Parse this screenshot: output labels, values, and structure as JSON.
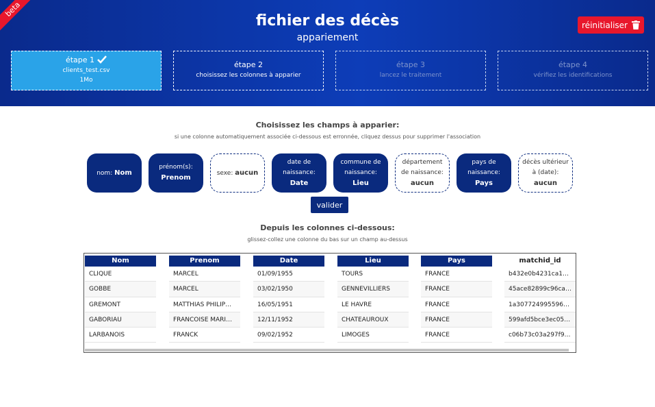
{
  "header": {
    "beta": "beta",
    "title": "fichier des décès",
    "subtitle": "appariement",
    "reset_label": "réinitialiser",
    "reset_icon": "trash-icon"
  },
  "steps": [
    {
      "title": "étape 1",
      "line1": "clients_test.csv",
      "line2": "1Mo",
      "state": "done"
    },
    {
      "title": "étape 2",
      "line1": "choisissez les colonnes à apparier",
      "state": "active"
    },
    {
      "title": "étape 3",
      "line1": "lancez le traitement",
      "state": "future"
    },
    {
      "title": "étape 4",
      "line1": "vérifiez les identifications",
      "state": "future"
    }
  ],
  "fields_section": {
    "title": "Choisissez les champs à apparier:",
    "hint": "si une colonne automatiquement associée ci-dessous est erronnée, cliquez dessus pour supprimer l'association",
    "fields": [
      {
        "label": "nom:",
        "value": "Nom"
      },
      {
        "label": "prénom(s):",
        "value": "Prenom"
      },
      {
        "label": "sexe:",
        "value": "aucun"
      },
      {
        "label": "date de naissance:",
        "value": "Date"
      },
      {
        "label": "commune de naissance:",
        "value": "Lieu"
      },
      {
        "label": "département de naissance:",
        "value": "aucun"
      },
      {
        "label": "pays de naissance:",
        "value": "Pays"
      },
      {
        "label": "décès ultérieur à (date):",
        "value": "aucun"
      }
    ],
    "validate_label": "valider"
  },
  "columns_section": {
    "title": "Depuis les colonnes ci-dessous:",
    "hint": "glissez-collez une colonne du bas sur un champ au-dessus"
  },
  "table": {
    "columns": [
      "Nom",
      "Prenom",
      "Date",
      "Lieu",
      "Pays",
      "matchid_id"
    ],
    "rows": [
      [
        "CLIQUE",
        "MARCEL",
        "01/09/1955",
        "TOURS",
        "FRANCE",
        "b432e0b4231ca1…"
      ],
      [
        "GOBBE",
        "MARCEL",
        "03/02/1950",
        "GENNEVILLIERS",
        "FRANCE",
        "45ace82899c96ca…"
      ],
      [
        "GREMONT",
        "MATTHIAS PHILIP…",
        "16/05/1951",
        "LE HAVRE",
        "FRANCE",
        "1a307724995596…"
      ],
      [
        "GABORIAU",
        "FRANCOISE MARI…",
        "12/11/1952",
        "CHATEAUROUX",
        "FRANCE",
        "599afd5bce3ec05…"
      ],
      [
        "LARBANOIS",
        "FRANCK",
        "09/02/1952",
        "LIMOGES",
        "FRANCE",
        "c06b73c03a297f9…"
      ]
    ]
  },
  "colors": {
    "primary": "#0a2a7e",
    "header_blue": "#0d3db8",
    "done_step": "#2aa3e8",
    "danger": "#e8172c"
  }
}
